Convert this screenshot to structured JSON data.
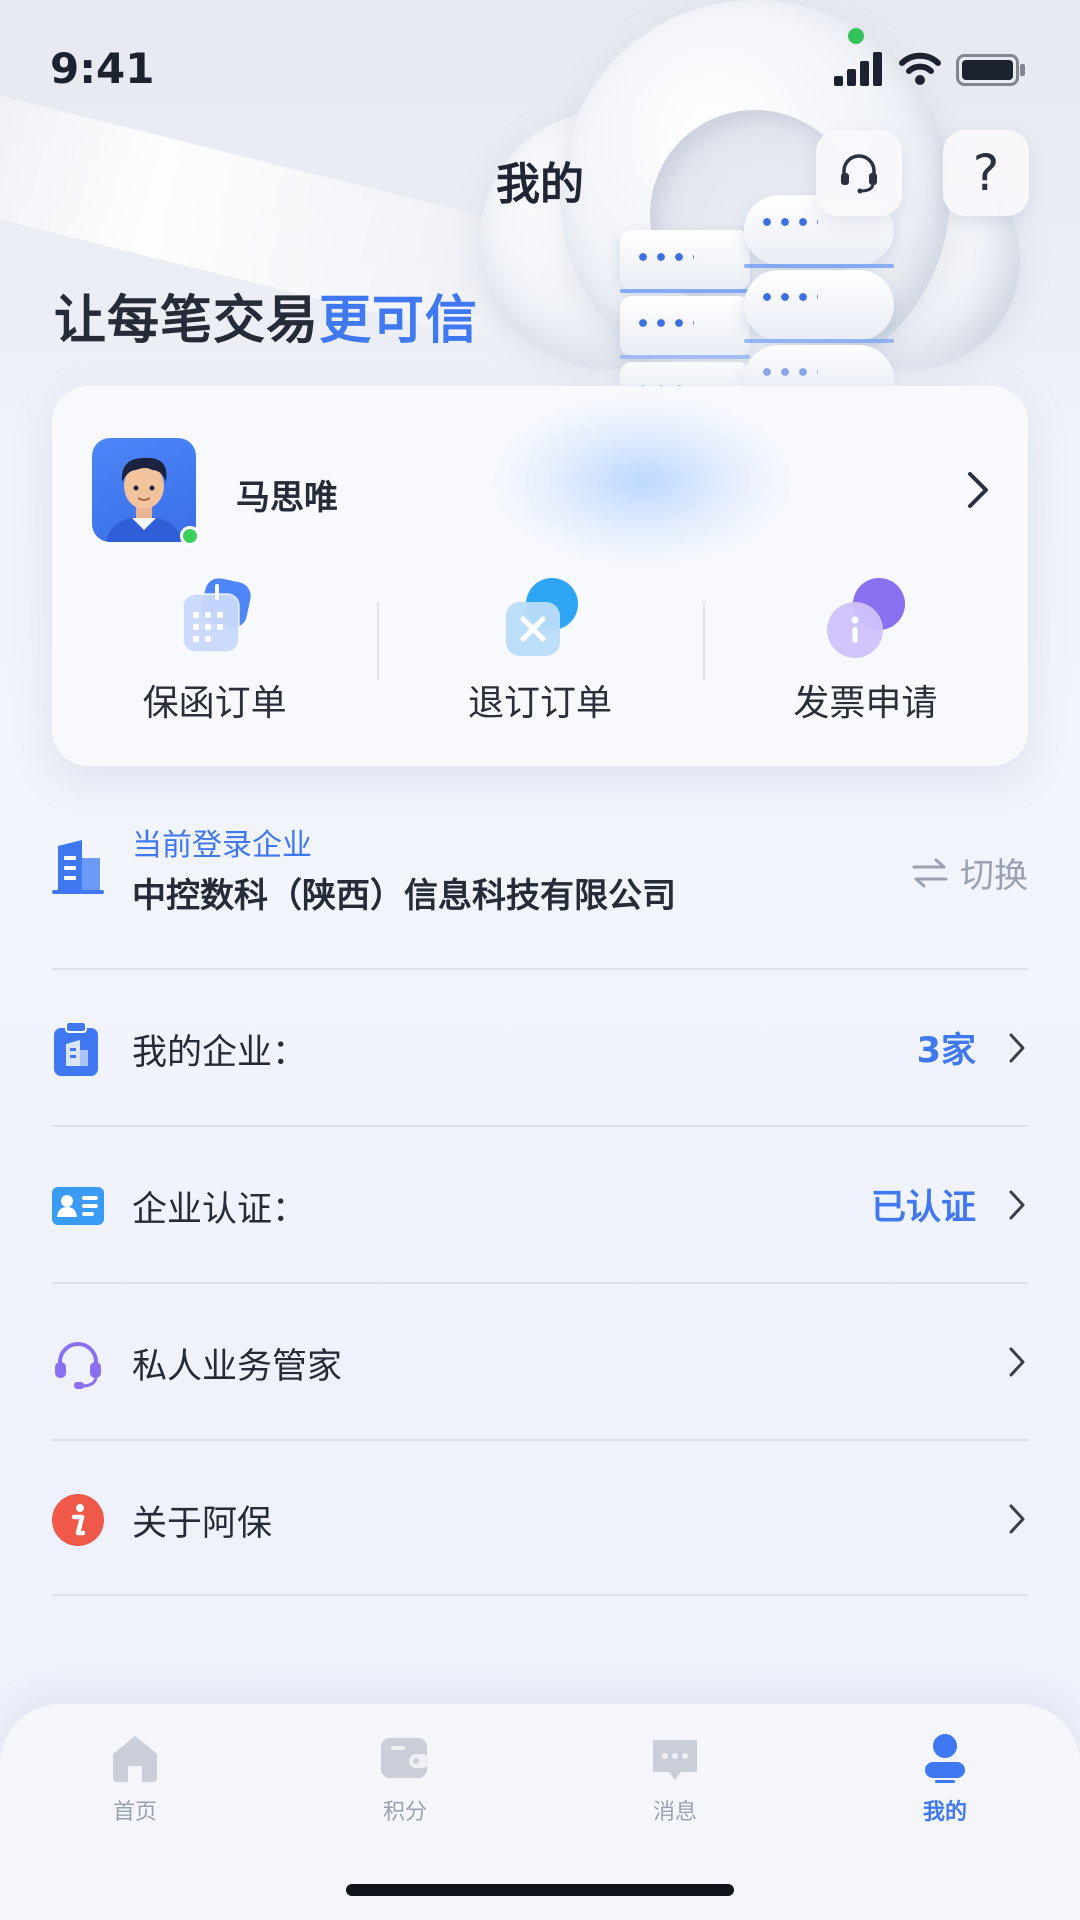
{
  "status_bar": {
    "time": "9:41"
  },
  "nav": {
    "title": "我的",
    "headset_icon": "headset-icon",
    "help_icon": "help-icon",
    "help_glyph": "?"
  },
  "hero": {
    "slogan_main": "让每笔交易",
    "slogan_highlight": "更可信"
  },
  "user": {
    "name": "马思唯",
    "actions": [
      {
        "label": "保函订单",
        "icon": "calendar-icon"
      },
      {
        "label": "退订订单",
        "icon": "cancel-icon"
      },
      {
        "label": "发票申请",
        "icon": "info-icon"
      }
    ]
  },
  "company": {
    "caption": "当前登录企业",
    "name": "中控数科（陕西）信息科技有限公司",
    "switch_label": "切换"
  },
  "menu": [
    {
      "label": "我的企业：",
      "value": "3家",
      "icon": "clipboard-building-icon"
    },
    {
      "label": "企业认证：",
      "value": "已认证",
      "icon": "id-card-icon"
    },
    {
      "label": "私人业务管家",
      "value": "",
      "icon": "headset-icon"
    },
    {
      "label": "关于阿保",
      "value": "",
      "icon": "info-icon"
    }
  ],
  "tabs": [
    {
      "label": "首页",
      "icon": "home-icon",
      "active": false
    },
    {
      "label": "积分",
      "icon": "wallet-icon",
      "active": false
    },
    {
      "label": "消息",
      "icon": "message-icon",
      "active": false
    },
    {
      "label": "我的",
      "icon": "user-icon",
      "active": true
    }
  ],
  "colors": {
    "accent": "#3f78f0",
    "text": "#262b38",
    "muted": "#9aa1b0",
    "online": "#3ccf5b"
  }
}
